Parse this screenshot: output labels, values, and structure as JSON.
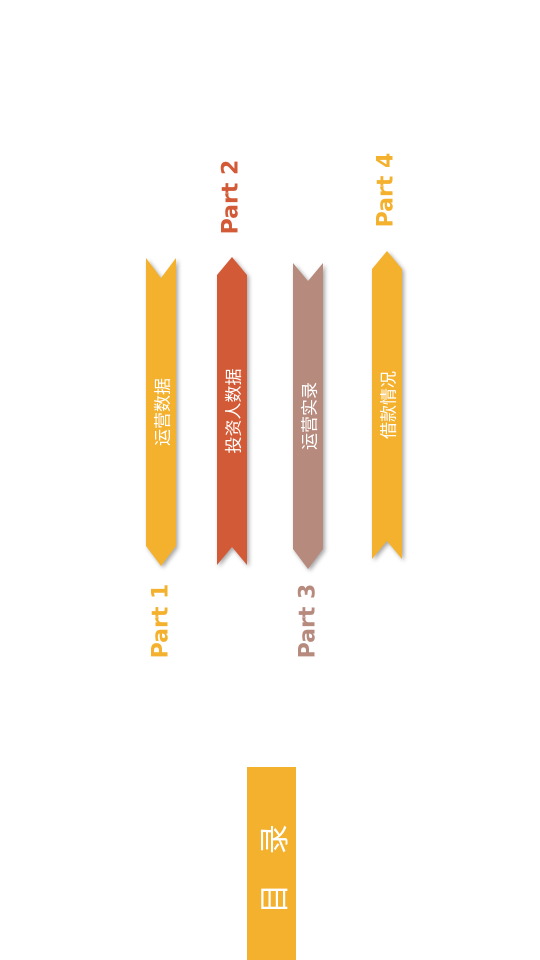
{
  "colors": {
    "yellow": "#f3b12e",
    "orange_red": "#d35a37",
    "dusty_rose": "#b78a7e",
    "white": "#ffffff"
  },
  "parts": [
    {
      "label": "Part 1",
      "title": "运营数据",
      "color": "#f3b12e"
    },
    {
      "label": "Part 2",
      "title": "投资人数据",
      "color": "#d35a37"
    },
    {
      "label": "Part 3",
      "title": "运营实录",
      "color": "#b78a7e"
    },
    {
      "label": "Part 4",
      "title": "借款情况",
      "color": "#f3b12e"
    }
  ],
  "toc": {
    "title": "目 录",
    "color": "#f3b12e"
  }
}
